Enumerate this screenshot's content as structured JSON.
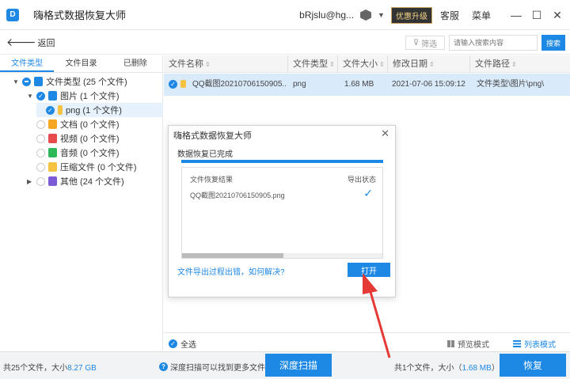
{
  "app": {
    "title": "嗨格式数据恢复大师",
    "user": "bRjslu@hg...",
    "upgrade_label": "优惠升级",
    "service_label": "客服",
    "menu_label": "菜单",
    "minimize": "—",
    "maximize": "☐",
    "close": "✕"
  },
  "toolbar": {
    "back_label": "返回",
    "filter_label": "筛选",
    "search_placeholder": "请输入搜索内容",
    "search_button": "搜索"
  },
  "sidebar": {
    "tabs": [
      "文件类型",
      "文件目录",
      "已删除"
    ],
    "active_tab": 0,
    "tree": [
      {
        "label": "文件类型 (25 个文件)",
        "icon": "folder-icon",
        "color": "#1e88e5"
      },
      {
        "label": "图片 (1 个文件)",
        "icon": "image-icon",
        "color": "#1e88e5"
      },
      {
        "label": "png (1 个文件)",
        "icon": "file-icon",
        "color": "#f5c242"
      },
      {
        "label": "文档 (0 个文件)",
        "icon": "document-icon",
        "color": "#f5a623"
      },
      {
        "label": "视频 (0 个文件)",
        "icon": "video-icon",
        "color": "#e84b4b"
      },
      {
        "label": "音频 (0 个文件)",
        "icon": "audio-icon",
        "color": "#2fb85a"
      },
      {
        "label": "压缩文件 (0 个文件)",
        "icon": "archive-icon",
        "color": "#f5c242"
      },
      {
        "label": "其他 (24 个文件)",
        "icon": "other-icon",
        "color": "#7b5bd6"
      }
    ]
  },
  "table": {
    "columns": [
      "文件名称",
      "文件类型",
      "文件大小",
      "修改日期",
      "文件路径"
    ],
    "rows": [
      {
        "name": "QQ截图20210706150905...",
        "type": "png",
        "size": "1.68 MB",
        "date": "2021-07-06 15:09:12",
        "path": "文件类型\\图片\\png\\"
      }
    ]
  },
  "dialog": {
    "title": "嗨格式数据恢复大师",
    "subtitle": "数据恢复已完成",
    "progress": 1.0,
    "col_result": "文件恢复结果",
    "col_status": "导出状态",
    "file_name": "QQ截图20210706150905.png",
    "help_link": "文件导出过程出错，如何解决?",
    "open_button": "打开"
  },
  "bottom": {
    "select_all": "全选",
    "preview_mode": "预览模式",
    "list_mode": "列表模式"
  },
  "footer": {
    "total_prefix": "共25个文件，大小",
    "total_size": "8.27 GB",
    "hint": "深度扫描可以找到更多文件",
    "deep_scan_button": "深度扫描",
    "selected_prefix": "共1个文件，大小（",
    "selected_size": "1.68 MB",
    "selected_suffix": "）",
    "recover_button": "恢复"
  },
  "colors": {
    "accent": "#1e88e5",
    "annotation_arrow": "#e53935"
  }
}
